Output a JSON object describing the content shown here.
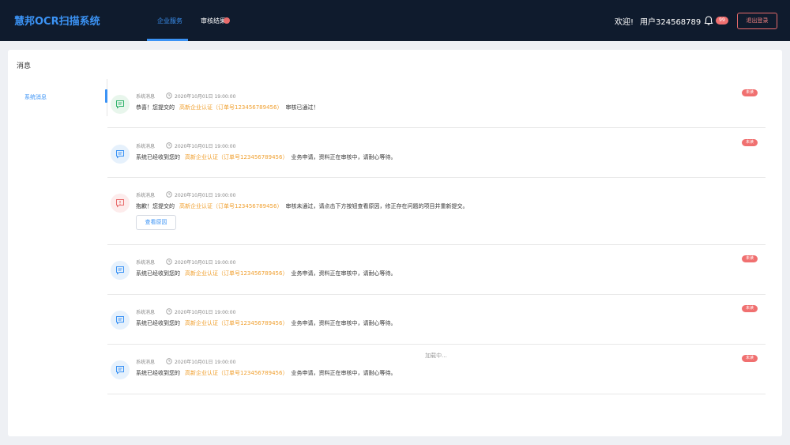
{
  "header": {
    "brand": "慧邦OCR扫描系统",
    "tabs": [
      {
        "label": "企业服务",
        "active": true
      },
      {
        "label": "审核结果",
        "active": false
      }
    ],
    "welcome": "欢迎!",
    "username": "用户324568789",
    "notification_count": "99",
    "logout_label": "退出登录",
    "accent_color": "#3b93f5"
  },
  "panel": {
    "title": "消息",
    "sidebar": {
      "items": [
        {
          "label": "系统消息",
          "active": true
        }
      ]
    }
  },
  "messages": [
    {
      "type": "系统消息",
      "time": "2020年10月01日 19:00:00",
      "icon": "message-icon",
      "status": "success",
      "prefix": "恭喜！您提交的",
      "highlight": "高新企业认证（订单号123456789456）",
      "suffix": "审核已通过！",
      "unread": "未读"
    },
    {
      "type": "系统消息",
      "time": "2020年10月01日 19:00:00",
      "icon": "message-icon",
      "status": "info",
      "prefix": "系统已经收到您的",
      "highlight": "高新企业认证（订单号123456789456）",
      "suffix": "业务申请，资料正在审核中，请耐心等待。",
      "unread": "未读"
    },
    {
      "type": "系统消息",
      "time": "2020年10月01日 19:00:00",
      "icon": "alert-message-icon",
      "status": "error",
      "prefix": "抱歉！您提交的",
      "highlight": "高新企业认证（订单号123456789456）",
      "suffix": "审核未通过，请点击下方按钮查看原因，修正存在问题的项目并重新提交。",
      "button": "查看原因"
    },
    {
      "type": "系统消息",
      "time": "2020年10月01日 19:00:00",
      "icon": "message-icon",
      "status": "info",
      "prefix": "系统已经收到您的",
      "highlight": "高新企业认证（订单号123456789456）",
      "suffix": "业务申请，资料正在审核中，请耐心等待。",
      "unread": "未读"
    },
    {
      "type": "系统消息",
      "time": "2020年10月01日 19:00:00",
      "icon": "message-icon",
      "status": "info",
      "prefix": "系统已经收到您的",
      "highlight": "高新企业认证（订单号123456789456）",
      "suffix": "业务申请，资料正在审核中，请耐心等待。",
      "unread": "未读"
    },
    {
      "type": "系统消息",
      "time": "2020年10月01日 19:00:00",
      "icon": "message-icon",
      "status": "info",
      "prefix": "系统已经收到您的",
      "highlight": "高新企业认证（订单号123456789456）",
      "suffix": "业务申请，资料正在审核中，请耐心等待。",
      "unread": "未读"
    }
  ],
  "loading_text": "加载中..."
}
